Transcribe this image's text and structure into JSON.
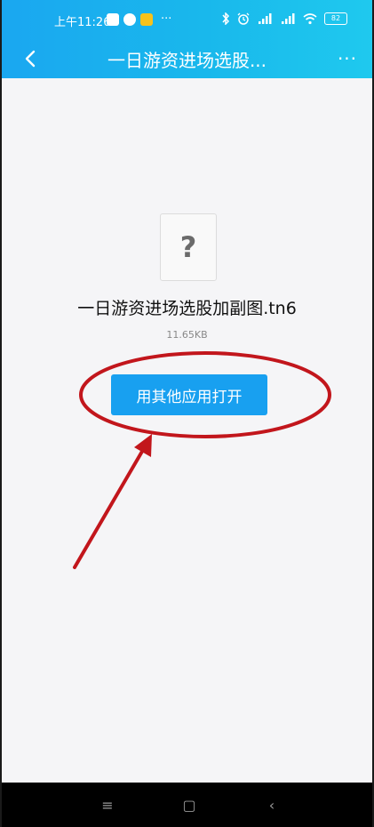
{
  "status_bar": {
    "time": "上午11:26",
    "more_indicator": "···",
    "battery": "82",
    "icons": [
      "bluetooth-icon",
      "alarm-icon",
      "signal-icon",
      "signal-icon",
      "wifi-icon",
      "battery-icon"
    ]
  },
  "header": {
    "title": "一日游资进场选股...",
    "back_icon": "chevron-left-icon",
    "more_icon": "more-dots-icon",
    "more_label": "···"
  },
  "file": {
    "icon_glyph": "?",
    "name": "一日游资进场选股加副图.tn6",
    "size": "11.65KB"
  },
  "actions": {
    "open_with_other_app": "用其他应用打开"
  },
  "system_nav": {
    "menu_glyph": "≡",
    "home_glyph": "▢",
    "back_glyph": "‹"
  },
  "colors": {
    "header_start": "#1aa7f0",
    "header_end": "#1fc9ee",
    "button": "#18a0f0",
    "annotation": "#c2161c",
    "background": "#f5f5f7"
  }
}
